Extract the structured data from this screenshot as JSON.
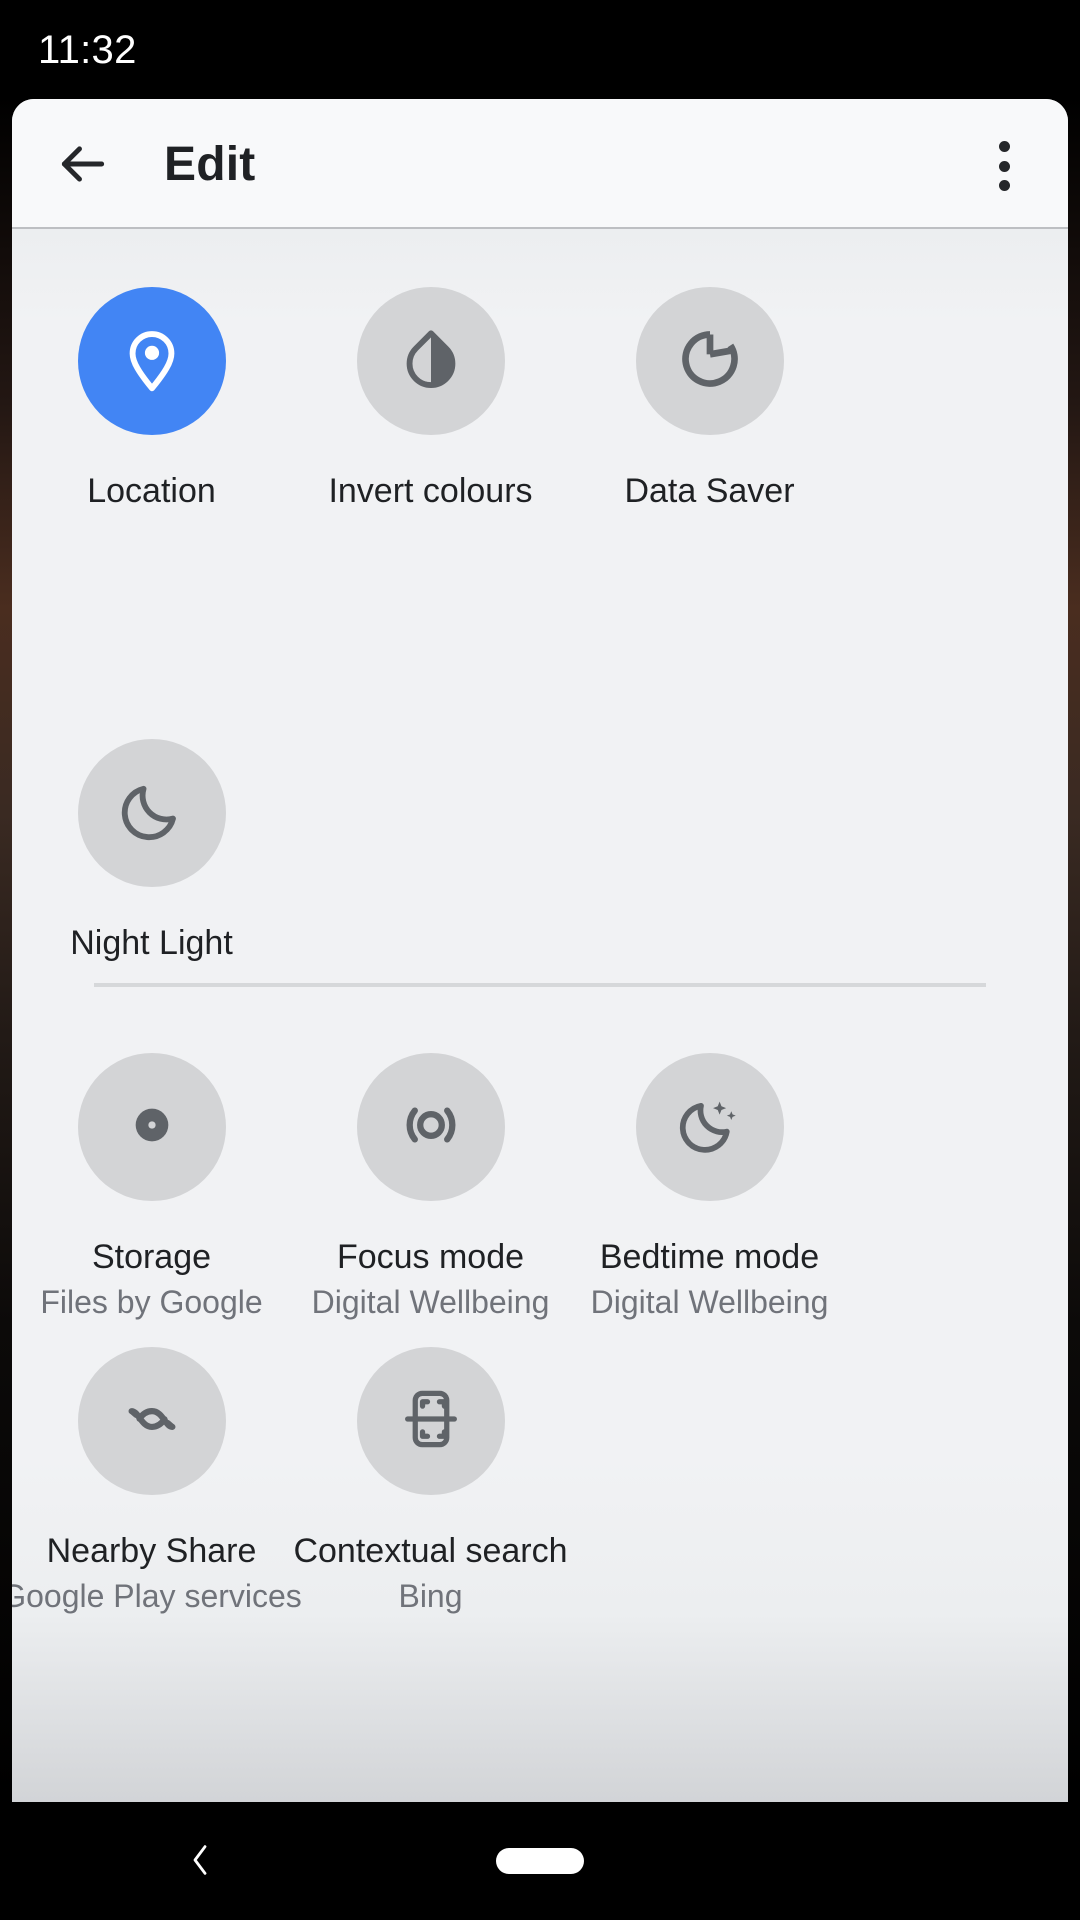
{
  "status_bar": {
    "time": "11:32"
  },
  "app_bar": {
    "back_icon": "arrow-back-icon",
    "title": "Edit",
    "overflow_icon": "more-vert-icon"
  },
  "sections": [
    {
      "id": "section-quick-settings",
      "tiles": [
        {
          "label": "Location",
          "subtitle": "",
          "icon": "location-pin-icon",
          "active": true
        },
        {
          "label": "Invert colours",
          "subtitle": "",
          "icon": "invert-colours-drop-icon",
          "active": false
        },
        {
          "label": "Data Saver",
          "subtitle": "",
          "icon": "data-saver-ring-icon",
          "active": false
        },
        {
          "label": "Night Light",
          "subtitle": "",
          "icon": "night-light-moon-icon",
          "active": false
        }
      ]
    },
    {
      "id": "section-app-tiles",
      "tiles": [
        {
          "label": "Storage",
          "subtitle": "Files by Google",
          "icon": "storage-disc-icon",
          "active": false
        },
        {
          "label": "Focus mode",
          "subtitle": "Digital Wellbeing",
          "icon": "focus-mode-icon",
          "active": false
        },
        {
          "label": "Bedtime mode",
          "subtitle": "Digital Wellbeing",
          "icon": "bedtime-moon-sparkle-icon",
          "active": false
        },
        {
          "label": "Nearby Share",
          "subtitle": "Google Play services",
          "icon": "nearby-share-icon",
          "active": false
        },
        {
          "label": "Contextual search",
          "subtitle": "Bing",
          "icon": "contextual-search-scan-icon",
          "active": false
        }
      ]
    }
  ],
  "nav_bar": {
    "back_icon": "nav-back-chevron-icon",
    "home_icon": "nav-home-pill-icon"
  },
  "colors": {
    "accent": "#4285f4",
    "tile_bg": "#d3d4d6",
    "icon_fg": "#5f6368",
    "card_bg": "#f1f2f4",
    "appbar_bg": "#f8f9fa",
    "label": "#1f2124",
    "sublabel": "#70737a"
  }
}
